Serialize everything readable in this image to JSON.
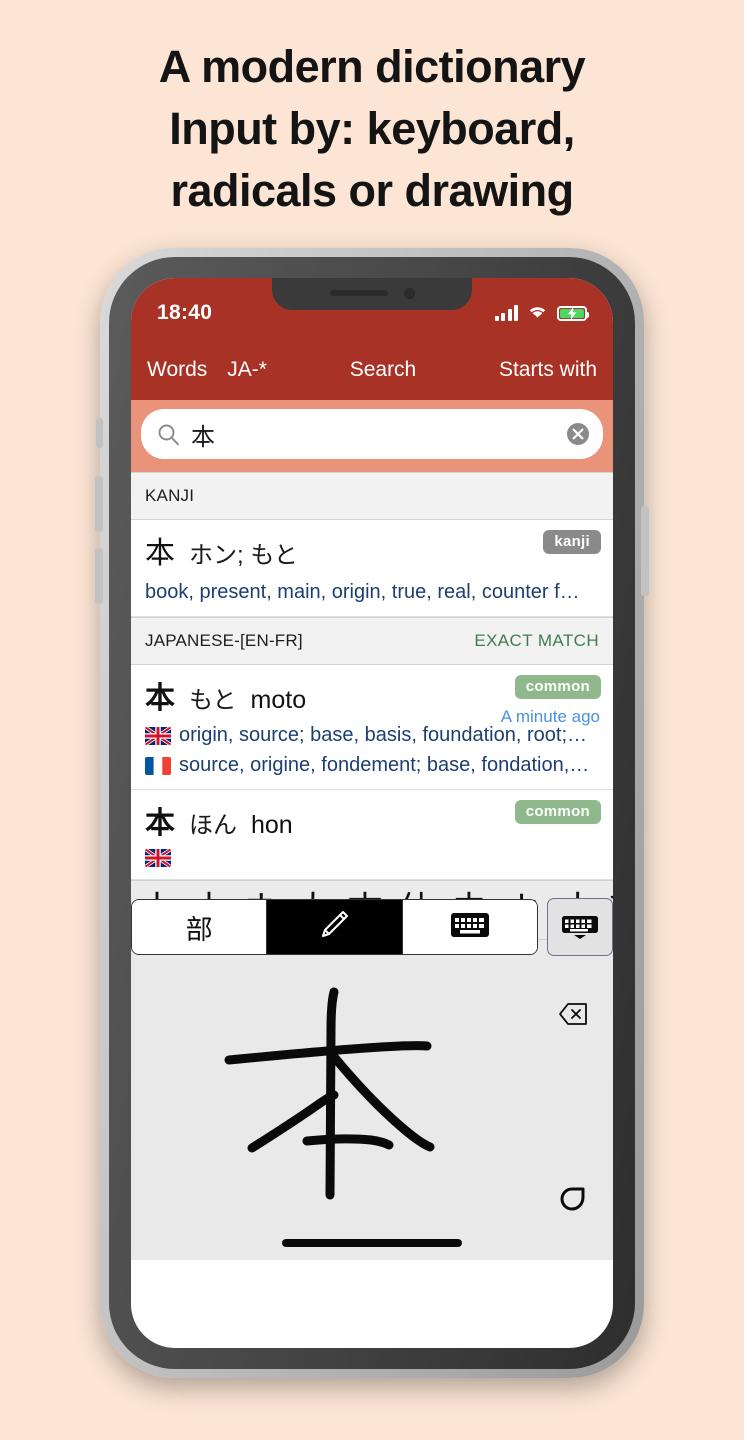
{
  "headline": {
    "line1": "A modern dictionary",
    "line2": "Input by: keyboard,",
    "line3": "radicals or drawing"
  },
  "colors": {
    "page_background": "#fce5d4",
    "navbar": "#a93226",
    "searchbar": "#e8937a",
    "badge_kanji": "#8a8a8a",
    "badge_common": "#8fb98c",
    "exact_match": "#3f7d4e",
    "gloss_text": "#1c3f72",
    "timestamp": "#4a90e2",
    "battery_fill": "#4cd864"
  },
  "statusbar": {
    "time": "18:40",
    "signal_icon": "signal-bars-icon",
    "wifi_icon": "wifi-icon",
    "battery_icon": "battery-charging-icon"
  },
  "navbar": {
    "words_label": "Words",
    "language_label": "JA-*",
    "title": "Search",
    "match_mode_label": "Starts with"
  },
  "search": {
    "value": "本",
    "placeholder": "Search",
    "search_icon": "search-icon",
    "clear_icon": "clear-circle-icon"
  },
  "sections": [
    {
      "header_left": "KANJI",
      "header_right": "",
      "entries": [
        {
          "kanji": "本",
          "reading": "ホン; もと",
          "romaji": "",
          "badge": "kanji",
          "badge_type": "kanji",
          "timestamp": "",
          "gloss_single": "book, present, main, origin, true, real, counter f…",
          "glosses": []
        }
      ]
    },
    {
      "header_left": "JAPANESE-[EN-FR]",
      "header_right": "EXACT MATCH",
      "entries": [
        {
          "kanji": "本",
          "reading": "もと",
          "romaji": "moto",
          "badge": "common",
          "badge_type": "common",
          "timestamp": "A minute ago",
          "gloss_single": "",
          "glosses": [
            {
              "flag": "uk-flag-icon",
              "text": "origin, source; base, basis, foundation, root;…"
            },
            {
              "flag": "fr-flag-icon",
              "text": "source, origine, fondement; base, fondation,…"
            }
          ]
        },
        {
          "kanji": "本",
          "reading": "ほん",
          "romaji": "hon",
          "badge": "common",
          "badge_type": "common",
          "timestamp": "",
          "gloss_single": "",
          "glosses": []
        }
      ]
    }
  ],
  "input_toolbar": {
    "radicals_label": "部",
    "radicals_icon": "radical-icon",
    "drawing_icon": "pencil-icon",
    "keyboard_icon": "keyboard-icon",
    "dismiss_icon": "keyboard-dismiss-icon",
    "active_mode": "drawing"
  },
  "candidates": [
    "本",
    "木",
    "ネ",
    "太",
    "末",
    "体",
    "未",
    "ホ",
    "才",
    "禾",
    "才"
  ],
  "canvas": {
    "drawn_character": "本",
    "backspace_icon": "backspace-icon",
    "undo_icon": "undo-icon"
  },
  "home_indicator": "home-indicator-bar"
}
